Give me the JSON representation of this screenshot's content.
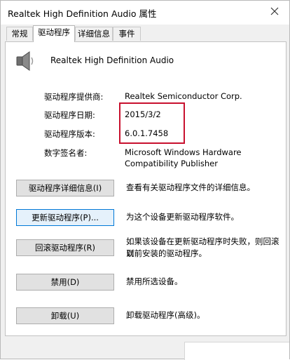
{
  "window": {
    "title": "Realtek High Definition Audio 属性"
  },
  "tabs": [
    {
      "label": "常规"
    },
    {
      "label": "驱动程序"
    },
    {
      "label": "详细信息"
    },
    {
      "label": "事件"
    }
  ],
  "device": {
    "name": "Realtek High Definition Audio",
    "icon": "speaker-icon"
  },
  "info": {
    "provider_label": "驱动程序提供商:",
    "provider_value": "Realtek Semiconductor Corp.",
    "date_label": "驱动程序日期:",
    "date_value": "2015/3/2",
    "version_label": "驱动程序版本:",
    "version_value": "6.0.1.7458",
    "signer_label": "数字签名者:",
    "signer_value_line1": "Microsoft Windows Hardware",
    "signer_value_line2": "Compatibility Publisher"
  },
  "actions": [
    {
      "button": "驱动程序详细信息(I)",
      "desc": "查看有关驱动程序文件的详细信息。"
    },
    {
      "button": "更新驱动程序(P)...",
      "desc": "为这个设备更新驱动程序软件。"
    },
    {
      "button": "回滚驱动程序(R)",
      "desc_line1": "如果该设备在更新驱动程序时失败，则回滚到",
      "desc_line2": "以前安装的驱动程序。"
    },
    {
      "button": "禁用(D)",
      "desc": "禁用所选设备。"
    },
    {
      "button": "卸载(U)",
      "desc": "卸载驱动程序(高级)。"
    }
  ],
  "colors": {
    "highlight_border": "#c8102e",
    "focus_border": "#0078d7"
  }
}
